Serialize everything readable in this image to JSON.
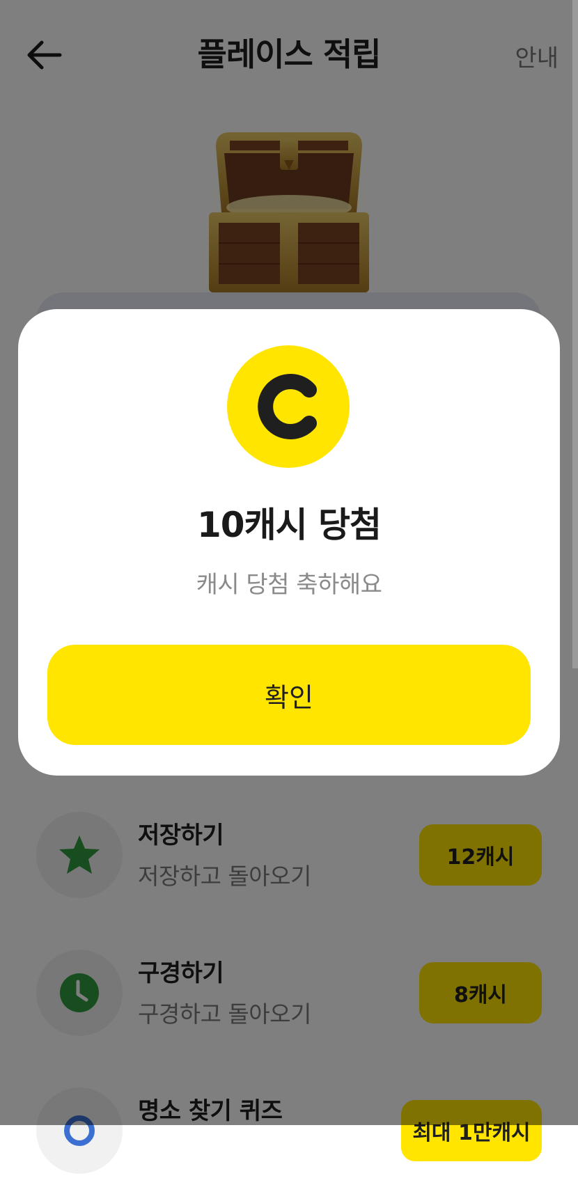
{
  "header": {
    "title": "플레이스 적립",
    "guide_label": "안내"
  },
  "modal": {
    "coin_letter": "C",
    "title": "10캐시 당첨",
    "subtitle": "캐시 당첨 축하해요",
    "confirm_label": "확인"
  },
  "missions": [
    {
      "title": "저장하기",
      "subtitle": "저장하고 돌아오기",
      "reward": "12캐시",
      "icon": "star-icon",
      "icon_color": "#2e9a3e"
    },
    {
      "title": "구경하기",
      "subtitle": "구경하고 돌아오기",
      "reward": "8캐시",
      "icon": "clock-icon",
      "icon_color": "#2e9a3e"
    },
    {
      "title": "명소 찾기 퀴즈",
      "subtitle": "",
      "reward": "최대 1만캐시",
      "icon": "search-icon",
      "icon_color": "#3b6fd1"
    }
  ],
  "colors": {
    "accent": "#ffe500",
    "overlay": "rgba(0,0,0,0.5)",
    "text_primary": "#1f1f1f",
    "text_secondary": "#8a8a8a"
  }
}
